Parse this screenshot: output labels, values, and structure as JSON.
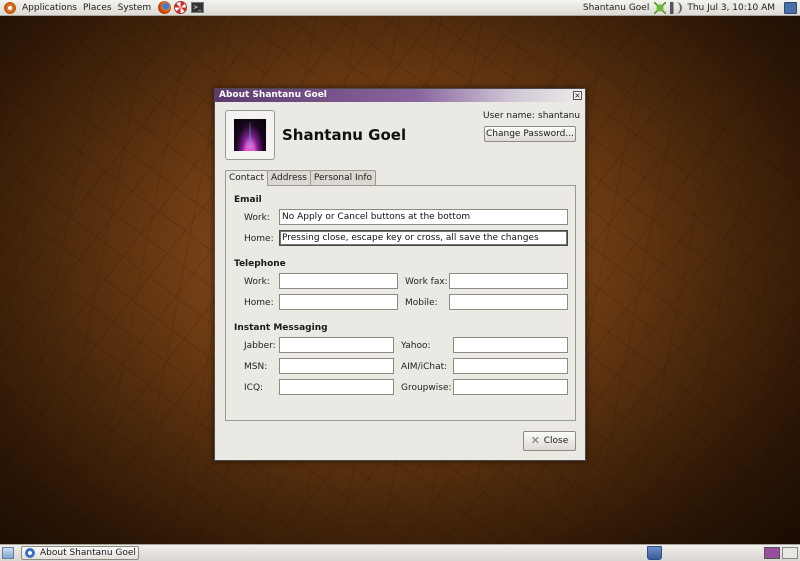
{
  "top_panel": {
    "menus": [
      "Applications",
      "Places",
      "System"
    ],
    "user": "Shantanu Goel",
    "clock": "Thu Jul  3, 10:10 AM"
  },
  "window": {
    "title": "About Shantanu Goel",
    "full_name": "Shantanu Goel",
    "username_label": "User name:",
    "username_value": "shantanu",
    "change_password": "Change Password...",
    "tabs": [
      "Contact",
      "Address",
      "Personal Info"
    ],
    "email": {
      "section": "Email",
      "work_label": "Work:",
      "work_value": "No Apply or Cancel buttons at the bottom",
      "home_label": "Home:",
      "home_value": "Pressing close, escape key or cross, all save the changes"
    },
    "telephone": {
      "section": "Telephone",
      "work_label": "Work:",
      "work_fax_label": "Work fax:",
      "home_label": "Home:",
      "mobile_label": "Mobile:"
    },
    "im": {
      "section": "Instant Messaging",
      "jabber_label": "Jabber:",
      "yahoo_label": "Yahoo:",
      "msn_label": "MSN:",
      "aim_label": "AIM/iChat:",
      "icq_label": "ICQ:",
      "groupwise_label": "Groupwise:"
    },
    "close_label": "Close"
  },
  "bottom_panel": {
    "task_label": "About Shantanu Goel"
  }
}
